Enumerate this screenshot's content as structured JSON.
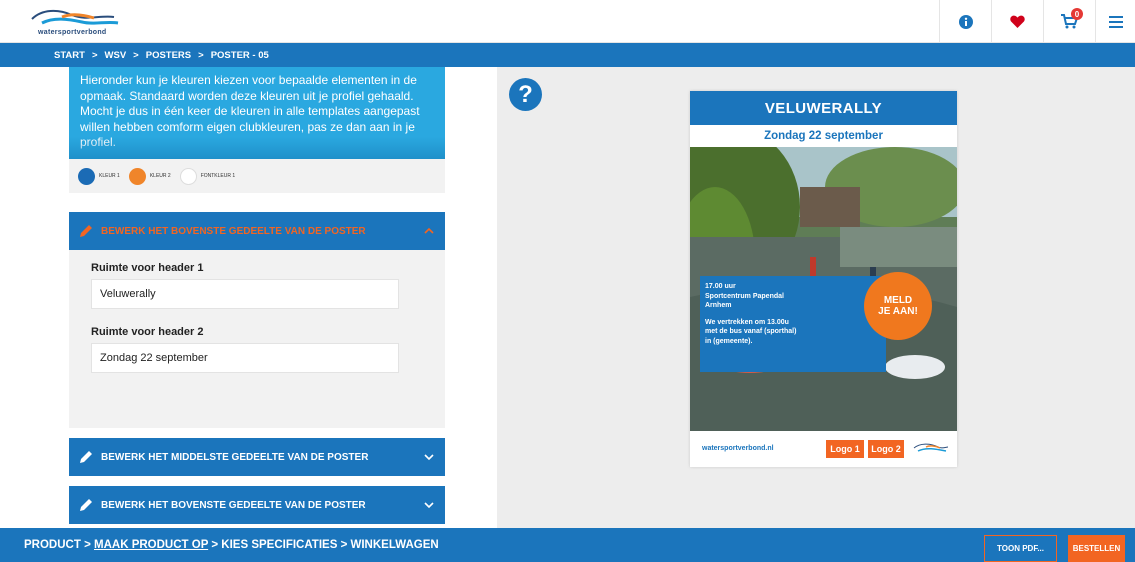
{
  "brand": {
    "name": "watersportverbond"
  },
  "header": {
    "cart_count": "0"
  },
  "breadcrumb": [
    "START",
    ">",
    "WSV",
    ">",
    "POSTERS",
    ">",
    "POSTER - 05"
  ],
  "colors": {
    "primary": "#1b75bc",
    "accent": "#f26522",
    "info": "#2aa8e0"
  },
  "editor": {
    "intro_text": "Hieronder kun je kleuren kiezen voor bepaalde elementen in de opmaak. Standaard worden deze kleuren uit je profiel gehaald. Mocht je dus in één keer de kleuren in alle templates aangepast willen hebben comform eigen clubkleuren, pas ze dan aan in je profiel.",
    "swatches": [
      {
        "label": "KLEUR 1",
        "color": "#1b6bb5"
      },
      {
        "label": "KLEUR 2",
        "color": "#f0852a"
      },
      {
        "label": "FONTKLEUR 1",
        "color": "#ffffff"
      }
    ],
    "sections": {
      "top_open": "BEWERK HET BOVENSTE GEDEELTE VAN DE POSTER",
      "middle": "BEWERK HET MIDDELSTE GEDEELTE VAN DE POSTER",
      "top_again": "BEWERK HET BOVENSTE GEDEELTE VAN DE POSTER"
    },
    "fields": {
      "header1_label": "Ruimte voor header 1",
      "header1_value": "Veluwerally",
      "header2_label": "Ruimte voor header 2",
      "header2_value": "Zondag 22 september"
    }
  },
  "poster": {
    "title": "VELUWERALLY",
    "subtitle": "Zondag 22 september",
    "info_line1": "17.00 uur",
    "info_line2": "Sportcentrum Papendal",
    "info_line3": "Arnhem",
    "info_line4": "We vertrekken om 13.00u",
    "info_line5": "met de bus vanaf (sporthal)",
    "info_line6": "in (gemeente).",
    "cta_line1": "MELD",
    "cta_line2": "JE AAN!",
    "url": "watersportverbond.nl",
    "logo1": "Logo 1",
    "logo2": "Logo 2"
  },
  "footer": {
    "step1": "PRODUCT",
    "sep": ">",
    "step2": "MAAK PRODUCT OP",
    "step3": "KIES SPECIFICATIES",
    "step4": "WINKELWAGEN",
    "pdf_button": "TOON PDF...",
    "order_button": "BESTELLEN"
  },
  "icons": [
    "info-icon",
    "heart-icon",
    "cart-icon",
    "menu-icon",
    "pencil-icon",
    "chevron-up-icon",
    "chevron-down-icon",
    "help-icon"
  ]
}
